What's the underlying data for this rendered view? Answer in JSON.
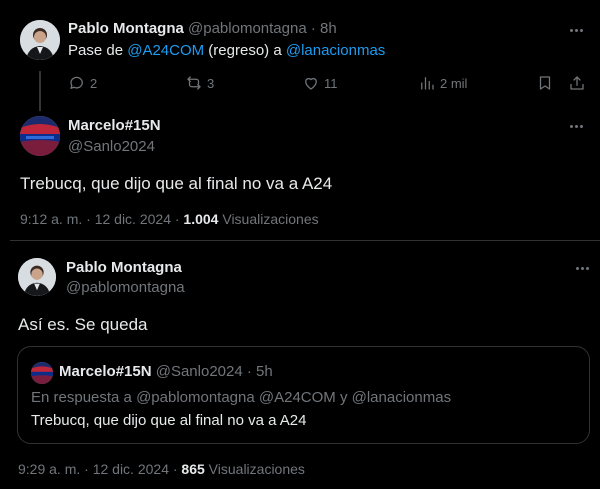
{
  "tweet1": {
    "display_name": "Pablo Montagna",
    "handle": "@pablomontagna",
    "separator": "·",
    "time": "8h",
    "text_prefix": "Pase de ",
    "mention1": "@A24COM",
    "text_middle": " (regreso) a ",
    "mention2": "@lanacionmas",
    "actions": {
      "replies": "2",
      "retweets": "3",
      "likes": "11",
      "views": "2 mil"
    }
  },
  "tweet2": {
    "display_name": "Marcelo#15N",
    "handle": "@Sanlo2024",
    "text": "Trebucq, que dijo que al final no va a A24",
    "timestamp": "9:12 a. m. · 12 dic. 2024 · ",
    "views_count": "1.004",
    "views_label": " Visualizaciones"
  },
  "tweet3": {
    "display_name": "Pablo Montagna",
    "handle": "@pablomontagna",
    "text": "Así es. Se queda",
    "quote": {
      "display_name": "Marcelo#15N",
      "handle": "@Sanlo2024",
      "separator": "·",
      "time": "5h",
      "reply_context": "En respuesta a @pablomontagna @A24COM y @lanacionmas",
      "text": "Trebucq, que dijo que al final no va a A24"
    },
    "timestamp": "9:29 a. m. · 12 dic. 2024 · ",
    "views_count": "865",
    "views_label": " Visualizaciones"
  },
  "colors": {
    "background": "#000000",
    "text": "#e7e9ea",
    "muted": "#71767b",
    "link": "#1d9bf0",
    "border": "#2f3336"
  },
  "icons": [
    "more-icon",
    "reply-icon",
    "retweet-icon",
    "like-icon",
    "views-icon",
    "bookmark-icon",
    "share-icon"
  ]
}
